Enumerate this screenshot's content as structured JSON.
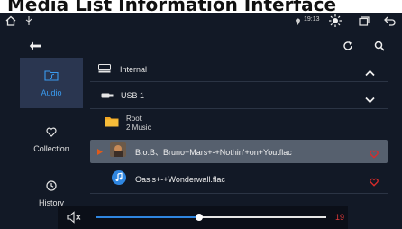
{
  "page_title": "Media List Information Interface",
  "status_bar": {
    "time": "19:13",
    "home_icon": "home-icon",
    "usb_icon": "usb-icon",
    "location_icon": "location-pin-icon",
    "brightness_icon": "brightness-icon",
    "window_icon": "window-icon",
    "back_icon": "back-arrow-icon"
  },
  "toolbar": {
    "back_icon": "back-arrow-icon",
    "refresh_icon": "refresh-icon",
    "search_icon": "search-icon"
  },
  "sidebar": {
    "items": [
      {
        "label": "Audio",
        "icon": "audio-folder-icon",
        "active": true
      },
      {
        "label": "Collection",
        "icon": "heart-outline-icon",
        "active": false
      },
      {
        "label": "History",
        "icon": "clock-icon",
        "active": false
      }
    ]
  },
  "storage": [
    {
      "label": "Internal",
      "icon": "internal-storage-icon",
      "chevron": "chevron-up-icon"
    },
    {
      "label": "USB 1",
      "icon": "usb-storage-icon",
      "chevron": "chevron-down-icon"
    }
  ],
  "folder": {
    "name": "Root",
    "count": "2 Music"
  },
  "songs": [
    {
      "title": "B.o.B、Bruno+Mars+-+Nothin'+on+You.flac",
      "selected": true,
      "playing": true
    },
    {
      "title": "Oasis+-+Wonderwall.flac",
      "selected": false,
      "playing": false
    }
  ],
  "player": {
    "mute_icon": "mute-speaker-icon",
    "volume": "19",
    "progress": 0.45,
    "accent": "#2f86e0",
    "volume_color": "#e23a3a"
  },
  "colors": {
    "background": "#121926",
    "sidebar_active": "#2a3650",
    "accent_text": "#3a9bf0",
    "heart": "#d92b2b",
    "playing_marker": "#e05a1a"
  }
}
